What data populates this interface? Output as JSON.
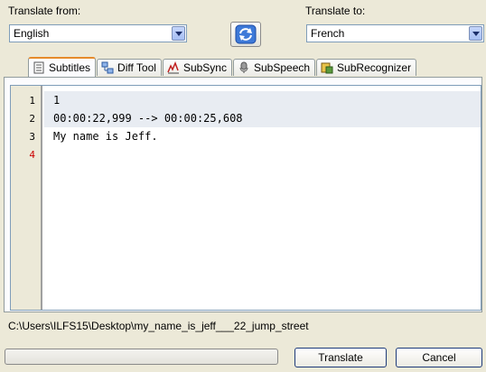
{
  "translate_from": {
    "label": "Translate from:",
    "selected": "English"
  },
  "translate_to": {
    "label": "Translate to:",
    "selected": "French"
  },
  "swap_button": {
    "icon": "swap-languages-icon"
  },
  "tabs": [
    {
      "label": "Subtitles",
      "icon": "document-icon",
      "active": true
    },
    {
      "label": "Diff Tool",
      "icon": "diff-icon",
      "active": false
    },
    {
      "label": "SubSync",
      "icon": "sync-icon",
      "active": false
    },
    {
      "label": "SubSpeech",
      "icon": "microphone-icon",
      "active": false
    },
    {
      "label": "SubRecognizer",
      "icon": "recognizer-icon",
      "active": false
    }
  ],
  "editor": {
    "line_numbers": [
      "1",
      "2",
      "3",
      "4"
    ],
    "lines": [
      "1",
      "00:00:22,999 --> 00:00:25,608",
      "My name is Jeff.",
      ""
    ]
  },
  "file_path": "C:\\Users\\ILFS15\\Desktop\\my_name_is_jeff___22_jump_street",
  "progress": {
    "value": 0
  },
  "buttons": {
    "translate": "Translate",
    "cancel": "Cancel"
  },
  "colors": {
    "accent_tab": "#e68b2c",
    "current_line_number": "#cc0000",
    "highlight_line": "#e8ecf2"
  }
}
